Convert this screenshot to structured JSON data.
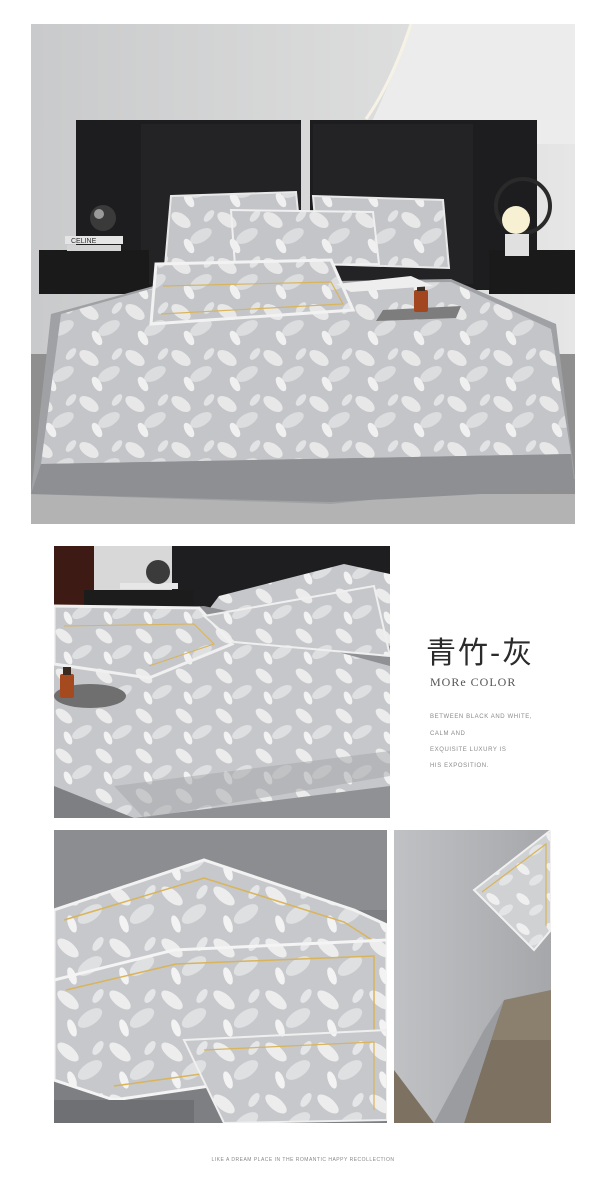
{
  "hero": {
    "book_label": "CELINE"
  },
  "color_block": {
    "title": "青竹-灰",
    "subtitle": "MORe COLOR",
    "description_lines": [
      "BETWEEN BLACK AND WHITE,",
      "CALM AND",
      "EXQUISITE LUXURY IS",
      "HIS EXPOSITION."
    ]
  },
  "footer": {
    "caption": "LIKE A DREAM PLACE IN THE ROMANTIC HAPPY RECOLLECTION"
  },
  "colors": {
    "bedding_grey": "#bfc1c4",
    "trim_gold": "#d9b45a",
    "headboard": "#1b1b1d",
    "wall": "#d7d8d9"
  }
}
